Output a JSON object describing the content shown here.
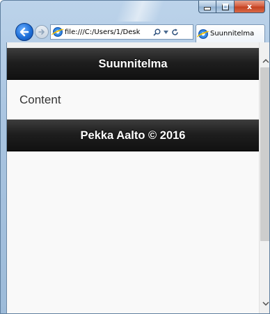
{
  "browser": {
    "address_url": "file:///C:/Users/1/Desk",
    "tab_title": "Suunnitelma",
    "icons": {
      "back": "back-arrow-icon",
      "forward": "forward-arrow-icon",
      "search": "search-icon",
      "dropdown": "chevron-down-icon",
      "refresh": "refresh-icon",
      "ie": "internet-explorer-icon"
    }
  },
  "window_controls": {
    "minimize": "minimize-icon",
    "maximize": "maximize-icon",
    "close_label": "x"
  },
  "page": {
    "header_title": "Suunnitelma",
    "content_text": "Content",
    "footer_text": "Pekka Aalto © 2016"
  },
  "colors": {
    "bar_background": "#1e1e1e",
    "page_background": "#f9f9f9",
    "back_button": "#1f6fd8"
  }
}
